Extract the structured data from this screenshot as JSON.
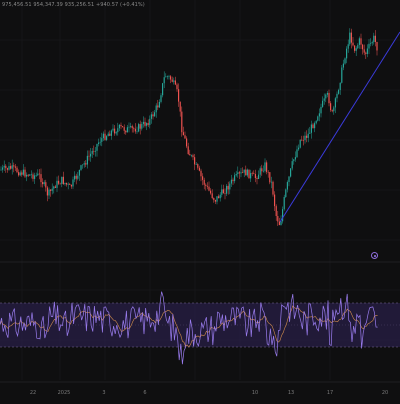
{
  "ohlc_readout": "975,456.51 954,347.39 935,256.51 +940.57 (+0.41%)",
  "colors": {
    "background": "#0f0f10",
    "up_candle": "#26a69a",
    "down_candle": "#ef5350",
    "trendline": "#3b3bdc",
    "rsi_line": "#9b7df0",
    "rsi_ma_line": "#f0a050",
    "rsi_band": "#2a1f4a",
    "rsi_level": "#7a6a9a",
    "grid": "#1b1b1e",
    "axis_text": "#7a7a7a"
  },
  "x_ticks": [
    "22",
    "2025",
    "3",
    "6",
    "10",
    "13",
    "17",
    "20"
  ],
  "chart_data": {
    "type": "candlestick",
    "price_path_keypoints": [
      [
        0,
        170
      ],
      [
        10,
        168
      ],
      [
        20,
        172
      ],
      [
        30,
        175
      ],
      [
        40,
        176
      ],
      [
        48,
        195
      ],
      [
        55,
        185
      ],
      [
        62,
        180
      ],
      [
        70,
        188
      ],
      [
        80,
        170
      ],
      [
        90,
        155
      ],
      [
        100,
        140
      ],
      [
        110,
        132
      ],
      [
        120,
        128
      ],
      [
        130,
        130
      ],
      [
        140,
        127
      ],
      [
        150,
        120
      ],
      [
        158,
        105
      ],
      [
        165,
        75
      ],
      [
        172,
        80
      ],
      [
        178,
        95
      ],
      [
        182,
        130
      ],
      [
        188,
        150
      ],
      [
        195,
        165
      ],
      [
        205,
        185
      ],
      [
        215,
        200
      ],
      [
        225,
        190
      ],
      [
        235,
        178
      ],
      [
        245,
        172
      ],
      [
        255,
        178
      ],
      [
        265,
        165
      ],
      [
        272,
        185
      ],
      [
        276,
        215
      ],
      [
        280,
        225
      ],
      [
        285,
        195
      ],
      [
        292,
        165
      ],
      [
        300,
        140
      ],
      [
        308,
        135
      ],
      [
        315,
        120
      ],
      [
        322,
        105
      ],
      [
        328,
        95
      ],
      [
        332,
        115
      ],
      [
        336,
        100
      ],
      [
        340,
        80
      ],
      [
        345,
        55
      ],
      [
        350,
        35
      ],
      [
        355,
        50
      ],
      [
        360,
        40
      ],
      [
        365,
        55
      ],
      [
        370,
        45
      ],
      [
        374,
        38
      ],
      [
        378,
        50
      ]
    ],
    "trendline": {
      "from": [
        280,
        222
      ],
      "to": [
        400,
        32
      ]
    },
    "rsi": {
      "upper_level": 70,
      "lower_level": 30,
      "range": [
        0,
        100
      ]
    }
  }
}
